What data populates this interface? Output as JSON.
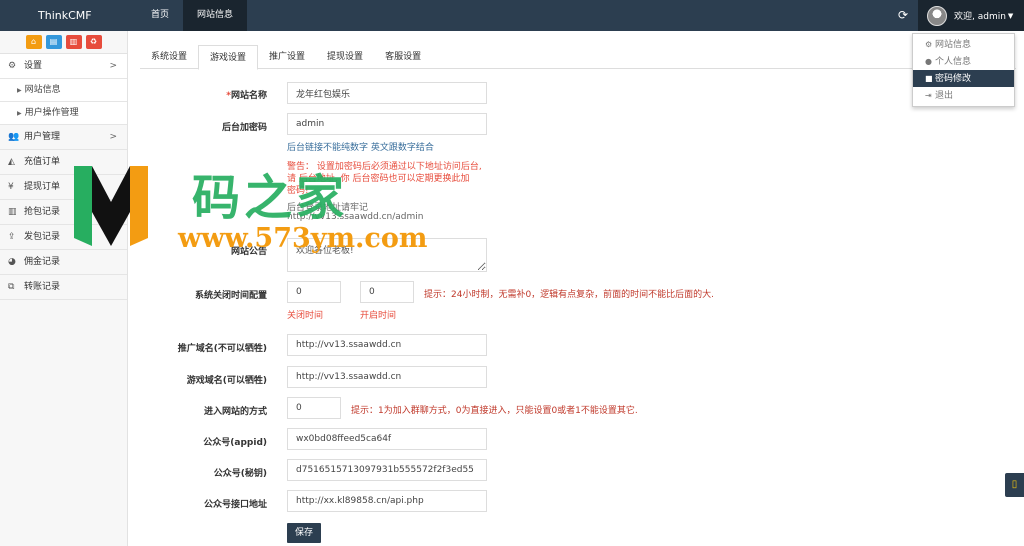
{
  "brand": "ThinkCMF",
  "topnav": [
    "首页",
    "网站信息"
  ],
  "user": {
    "welcome": "欢迎, admin"
  },
  "dropdown": [
    {
      "icon": "gear-icon",
      "label": "网站信息"
    },
    {
      "icon": "user-icon",
      "label": "个人信息"
    },
    {
      "icon": "lock-icon",
      "label": "密码修改"
    },
    {
      "icon": "logout-icon",
      "label": "退出"
    }
  ],
  "sidebar": {
    "settings": "设置",
    "sub": [
      "网站信息",
      "用户操作管理"
    ],
    "items": [
      "用户管理",
      "充值订单",
      "提现订单",
      "抢包记录",
      "发包记录",
      "佣金记录",
      "转账记录"
    ]
  },
  "tabs": [
    "系统设置",
    "游戏设置",
    "推广设置",
    "提现设置",
    "客服设置"
  ],
  "form": {
    "site_name": {
      "label": "网站名称",
      "required": "*",
      "value": "龙年红包娱乐"
    },
    "admin_code": {
      "label": "后台加密码",
      "value": "admin",
      "help": "后台链接不能纯数字 英文跟数字结合",
      "warning_line1": "警告：  设置加密码后必须通过以下地址访问后台,",
      "warning_line2": "请    后台地址, 你      后台密码也可以定期更换此加",
      "warning_line3": "密码!",
      "url_label": "后台登录地址请牢记",
      "url": "http://vv13.ssaawdd.cn/admin"
    },
    "notice": {
      "label": "网站公告",
      "value": "欢迎各位老板!"
    },
    "close_time": {
      "label": "系统关闭时间配置",
      "close_value": "0",
      "open_value": "0",
      "close_label": "关闭时间",
      "open_label": "开启时间",
      "note": "提示：24小时制，无需补0，逻辑有点复杂，前面的时间不能比后面的大."
    },
    "promo_domain": {
      "label": "推广域名(不可以牺牲)",
      "value": "http://vv13.ssaawdd.cn"
    },
    "game_domain": {
      "label": "游戏域名(可以牺牲)",
      "value": "http://vv13.ssaawdd.cn"
    },
    "entry_mode": {
      "label": "进入网站的方式",
      "value": "0",
      "note": "提示：1为加入群聊方式，0为直接进入，只能设置0或者1不能设置其它."
    },
    "appid": {
      "label": "公众号(appid)",
      "value": "wx0bd08ffeed5ca64f"
    },
    "secret": {
      "label": "公众号(秘钥)",
      "value": "d7516515713097931b555572f2f3ed55"
    },
    "api": {
      "label": "公众号接口地址",
      "value": "http://xx.kl89858.cn/api.php"
    },
    "save": "保存"
  },
  "watermark": {
    "text": "码之家",
    "url": "www.573ym.com"
  },
  "colors": {
    "topbar": "#2c3e50",
    "required": "#e74c3c",
    "help": "#3a6f9c",
    "save": "#2c3e50"
  }
}
